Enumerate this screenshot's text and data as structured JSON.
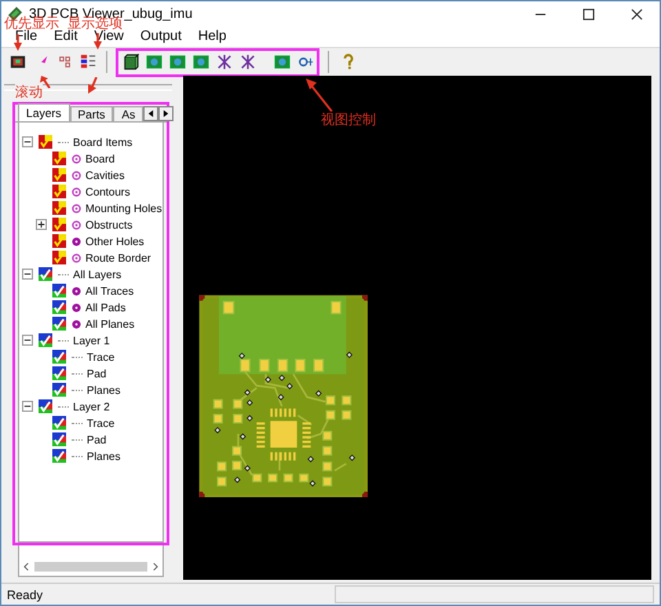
{
  "window": {
    "title": "3D PCB Viewer_ubug_imu"
  },
  "menu": [
    "File",
    "Edit",
    "View",
    "Output",
    "Help"
  ],
  "tabs": [
    {
      "label": "Layers",
      "selected": true
    },
    {
      "label": "Parts",
      "selected": false
    },
    {
      "label": "As",
      "selected": false
    }
  ],
  "tree": [
    {
      "label": "Board Items",
      "kind": "board",
      "expanded": true,
      "checked": true,
      "children": [
        {
          "label": "Board",
          "checked": true,
          "kind": "ring"
        },
        {
          "label": "Cavities",
          "checked": true,
          "kind": "ring"
        },
        {
          "label": "Contours",
          "checked": true,
          "kind": "ring"
        },
        {
          "label": "Mounting Holes",
          "checked": true,
          "kind": "ring"
        },
        {
          "label": "Obstructs",
          "checked": true,
          "kind": "ring",
          "expanded": false
        },
        {
          "label": "Other Holes",
          "checked": true,
          "kind": "dot"
        },
        {
          "label": "Route Border",
          "checked": true,
          "kind": "ring"
        }
      ]
    },
    {
      "label": "All Layers",
      "kind": "layer",
      "expanded": true,
      "checked": true,
      "children": [
        {
          "label": "All Traces",
          "checked": true,
          "kind": "dot"
        },
        {
          "label": "All Pads",
          "checked": true,
          "kind": "dot"
        },
        {
          "label": "All Planes",
          "checked": true,
          "kind": "dot"
        }
      ]
    },
    {
      "label": "Layer 1",
      "kind": "layer",
      "expanded": true,
      "checked": true,
      "children": [
        {
          "label": "Trace",
          "checked": true,
          "kind": "plain"
        },
        {
          "label": "Pad",
          "checked": true,
          "kind": "plain"
        },
        {
          "label": "Planes",
          "checked": true,
          "kind": "plain"
        }
      ]
    },
    {
      "label": "Layer 2",
      "kind": "layer",
      "expanded": true,
      "checked": true,
      "children": [
        {
          "label": "Trace",
          "checked": true,
          "kind": "plain"
        },
        {
          "label": "Pad",
          "checked": true,
          "kind": "plain"
        },
        {
          "label": "Planes",
          "checked": true,
          "kind": "plain"
        }
      ]
    }
  ],
  "status_bar": "Ready",
  "annotations": [
    "优先显示",
    "显示选项",
    "滚动",
    "视图控制"
  ]
}
